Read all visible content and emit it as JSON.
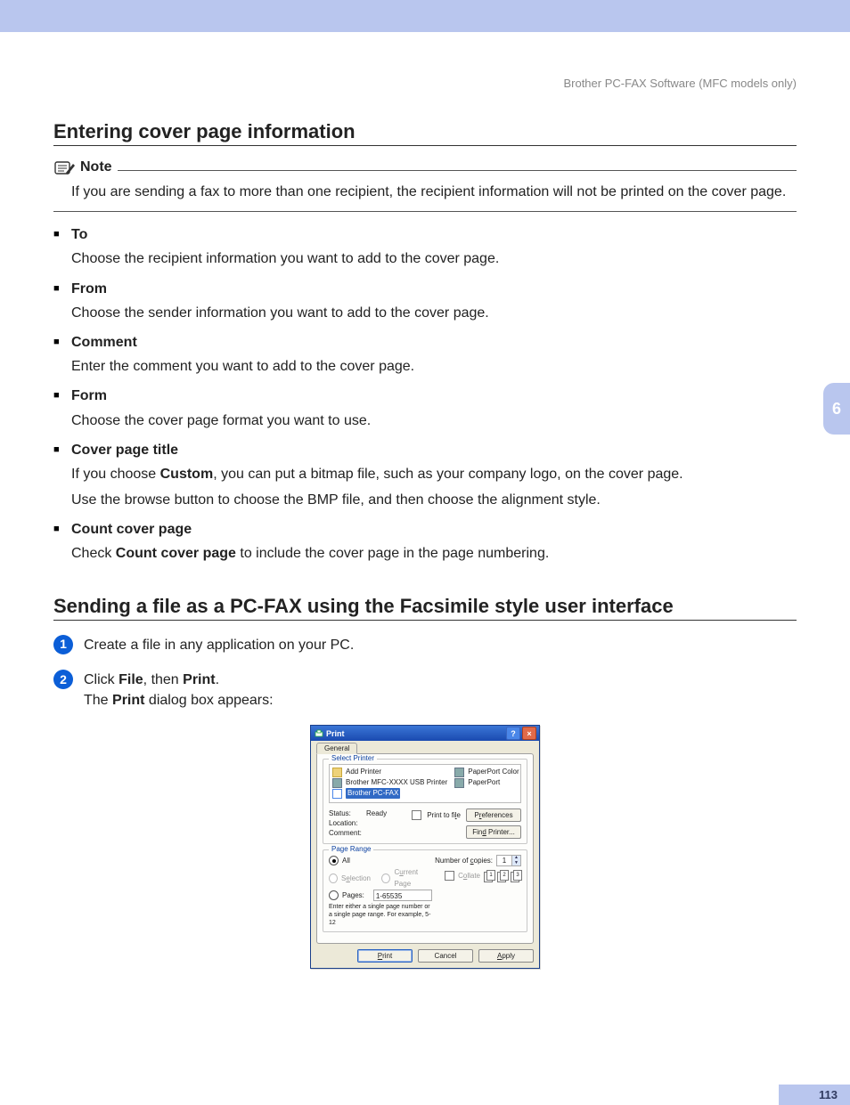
{
  "running_header": "Brother PC-FAX Software (MFC models only)",
  "chapter_tab": "6",
  "page_number": "113",
  "section1": {
    "title": "Entering cover page information",
    "note_label": "Note",
    "note_body": "If you are sending a fax to more than one recipient, the recipient information will not be printed on the cover page.",
    "items": [
      {
        "head": "To",
        "paras": [
          "Choose the recipient information you want to add to the cover page."
        ]
      },
      {
        "head": "From",
        "paras": [
          "Choose the sender information you want to add to the cover page."
        ]
      },
      {
        "head": "Comment",
        "paras": [
          "Enter the comment you want to add to the cover page."
        ]
      },
      {
        "head": "Form",
        "paras": [
          "Choose the cover page format you want to use."
        ]
      },
      {
        "head": "Cover page title",
        "paras": [
          "If you choose Custom, you can put a bitmap file, such as your company logo, on the cover page.",
          "Use the browse button to choose the BMP file, and then choose the alignment style."
        ],
        "bold_in_first": "Custom"
      },
      {
        "head": "Count cover page",
        "paras": [
          "Check Count cover page to include the cover page in the page numbering."
        ],
        "bold_in_first": "Count cover page"
      }
    ]
  },
  "section2": {
    "title": "Sending a file as a PC-FAX using the Facsimile style user interface",
    "steps": [
      {
        "n": "1",
        "html": "Create a file in any application on your PC."
      },
      {
        "n": "2",
        "html": "Click <b>File</b>, then <b>Print</b>.<br>The <b>Print</b> dialog box appears:"
      }
    ]
  },
  "dialog": {
    "title": "Print",
    "tab_general": "General",
    "group_select_printer": "Select Printer",
    "printers": {
      "add": "Add Printer",
      "p1": "Brother MFC-XXXX USB Printer",
      "p2_selected": "Brother PC-FAX",
      "p3": "PaperPort Color",
      "p4": "PaperPort"
    },
    "status_label": "Status:",
    "status_value": "Ready",
    "location_label": "Location:",
    "comment_label": "Comment:",
    "print_to_file": "Print to file",
    "btn_prefs": "Preferences",
    "btn_find": "Find Printer...",
    "group_page_range": "Page Range",
    "opt_all": "All",
    "opt_selection": "Selection",
    "opt_current": "Current Page",
    "opt_pages": "Pages:",
    "pages_value": "1-65535",
    "pages_hint": "Enter either a single page number or a single page range. For example, 5-12",
    "copies_label": "Number of copies:",
    "copies_value": "1",
    "collate_label": "Collate",
    "stack_a": "1",
    "stack_b": "2",
    "stack_c": "3",
    "btn_print": "Print",
    "btn_cancel": "Cancel",
    "btn_apply": "Apply"
  }
}
